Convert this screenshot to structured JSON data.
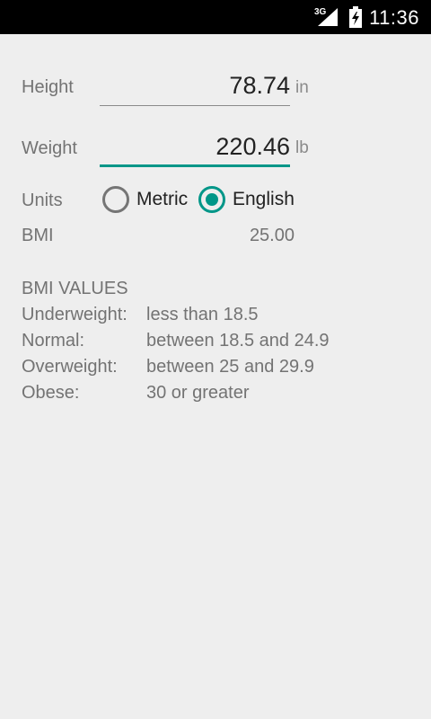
{
  "status_bar": {
    "network": "3G",
    "time": "11:36"
  },
  "form": {
    "height": {
      "label": "Height",
      "value": "78.74",
      "unit": "in"
    },
    "weight": {
      "label": "Weight",
      "value": "220.46",
      "unit": "lb"
    },
    "units": {
      "label": "Units",
      "options": [
        {
          "label": "Metric",
          "selected": false
        },
        {
          "label": "English",
          "selected": true
        }
      ]
    },
    "bmi": {
      "label": "BMI",
      "value": "25.00"
    }
  },
  "reference": {
    "heading": "BMI VALUES",
    "rows": [
      {
        "category": "Underweight:",
        "range": "less than 18.5"
      },
      {
        "category": "Normal:",
        "range": "between 18.5 and 24.9"
      },
      {
        "category": "Overweight:",
        "range": "between 25 and 29.9"
      },
      {
        "category": "Obese:",
        "range": "30 or greater"
      }
    ]
  },
  "colors": {
    "accent": "#009688",
    "background": "#eeeeee",
    "status_bar": "#000000"
  }
}
